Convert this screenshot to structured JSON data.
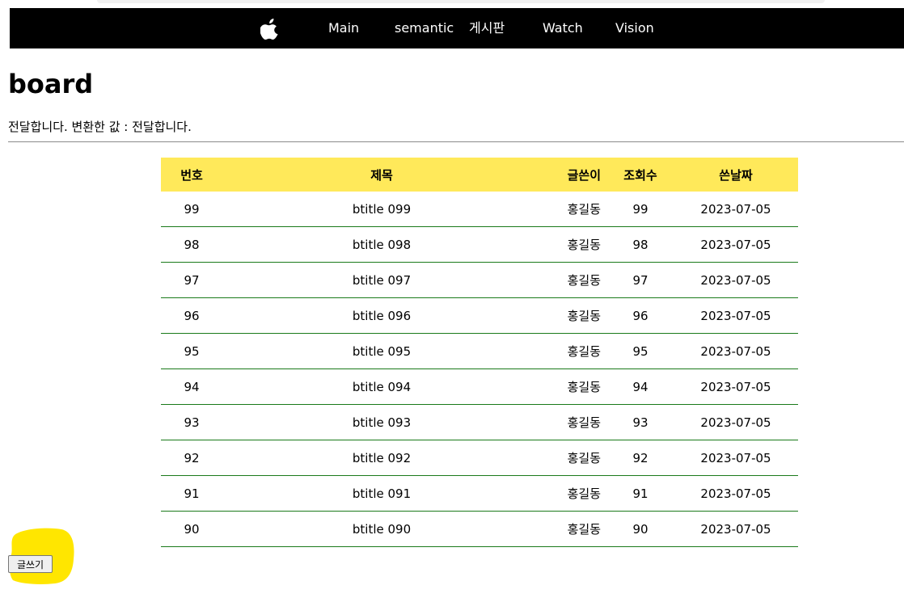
{
  "nav": {
    "logo_icon": "apple-icon",
    "links": [
      "Main",
      "semantic",
      "게시판",
      "Watch",
      "Vision"
    ]
  },
  "page": {
    "title": "board",
    "message": "전달합니다. 변환한 값 : 전달합니다."
  },
  "table": {
    "headers": [
      "번호",
      "제목",
      "글쓴이",
      "조회수",
      "쓴날짜"
    ],
    "rows": [
      [
        "99",
        "btitle 099",
        "홍길동",
        "99",
        "2023-07-05"
      ],
      [
        "98",
        "btitle 098",
        "홍길동",
        "98",
        "2023-07-05"
      ],
      [
        "97",
        "btitle 097",
        "홍길동",
        "97",
        "2023-07-05"
      ],
      [
        "96",
        "btitle 096",
        "홍길동",
        "96",
        "2023-07-05"
      ],
      [
        "95",
        "btitle 095",
        "홍길동",
        "95",
        "2023-07-05"
      ],
      [
        "94",
        "btitle 094",
        "홍길동",
        "94",
        "2023-07-05"
      ],
      [
        "93",
        "btitle 093",
        "홍길동",
        "93",
        "2023-07-05"
      ],
      [
        "92",
        "btitle 092",
        "홍길동",
        "92",
        "2023-07-05"
      ],
      [
        "91",
        "btitle 091",
        "홍길동",
        "91",
        "2023-07-05"
      ],
      [
        "90",
        "btitle 090",
        "홍길동",
        "90",
        "2023-07-05"
      ]
    ]
  },
  "actions": {
    "write_label": "글쓰기"
  },
  "colors": {
    "navbar": "#000000",
    "header_bg": "#ffe95a",
    "row_border": "#1a7a1a",
    "highlight": "#ffe600"
  }
}
